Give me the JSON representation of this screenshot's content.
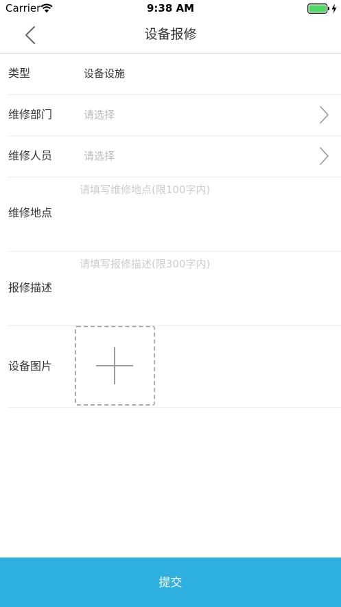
{
  "status_bar": {
    "carrier": "Carrier",
    "time": "9:38 AM",
    "icons": [
      "wifi-icon",
      "battery-icon",
      "charging-icon"
    ]
  },
  "nav": {
    "title": "设备报修",
    "back_icon": "chevron-left-icon"
  },
  "form": {
    "type": {
      "label": "类型",
      "value": "设备设施"
    },
    "department": {
      "label": "维修部门",
      "placeholder": "请选择",
      "icon": "chevron-right-icon"
    },
    "personnel": {
      "label": "维修人员",
      "placeholder": "请选择",
      "icon": "chevron-right-icon"
    },
    "location": {
      "label": "维修地点",
      "placeholder": "请填写维修地点(限100字内)"
    },
    "description": {
      "label": "报修描述",
      "placeholder": "请填写报修描述(限300字内)"
    },
    "images": {
      "label": "设备图片",
      "icon": "plus-icon"
    }
  },
  "submit": {
    "label": "提交"
  },
  "colors": {
    "accent": "#2EB0E0",
    "battery": "#4CD964",
    "text": "#333333",
    "placeholder": "#BBBBBB"
  }
}
